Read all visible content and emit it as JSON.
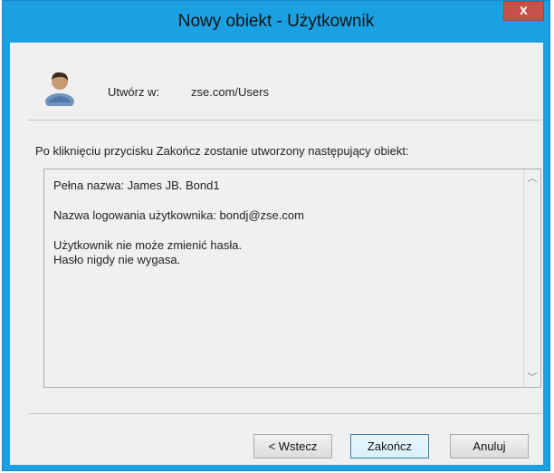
{
  "window": {
    "title": "Nowy obiekt - Użytkownik",
    "close_label": "x"
  },
  "header": {
    "create_in_label": "Utwórz w:",
    "create_in_value": "zse.com/Users",
    "icon": "user-icon"
  },
  "intro_text": "Po kliknięciu przycisku Zakończ zostanie utworzony następujący obiekt:",
  "summary": {
    "full_name": "Pełna nazwa: James JB. Bond1",
    "logon_name": "Nazwa logowania użytkownika: bondj@zse.com",
    "cannot_change_password": "Użytkownik nie może zmienić hasła.",
    "password_never_expires": "Hasło nigdy nie wygasa."
  },
  "buttons": {
    "back": "< Wstecz",
    "finish": "Zakończ",
    "cancel": "Anuluj"
  },
  "colors": {
    "titlebar": "#1ba1e2",
    "close_button": "#c7504b",
    "client_background": "#f0f0f0"
  }
}
